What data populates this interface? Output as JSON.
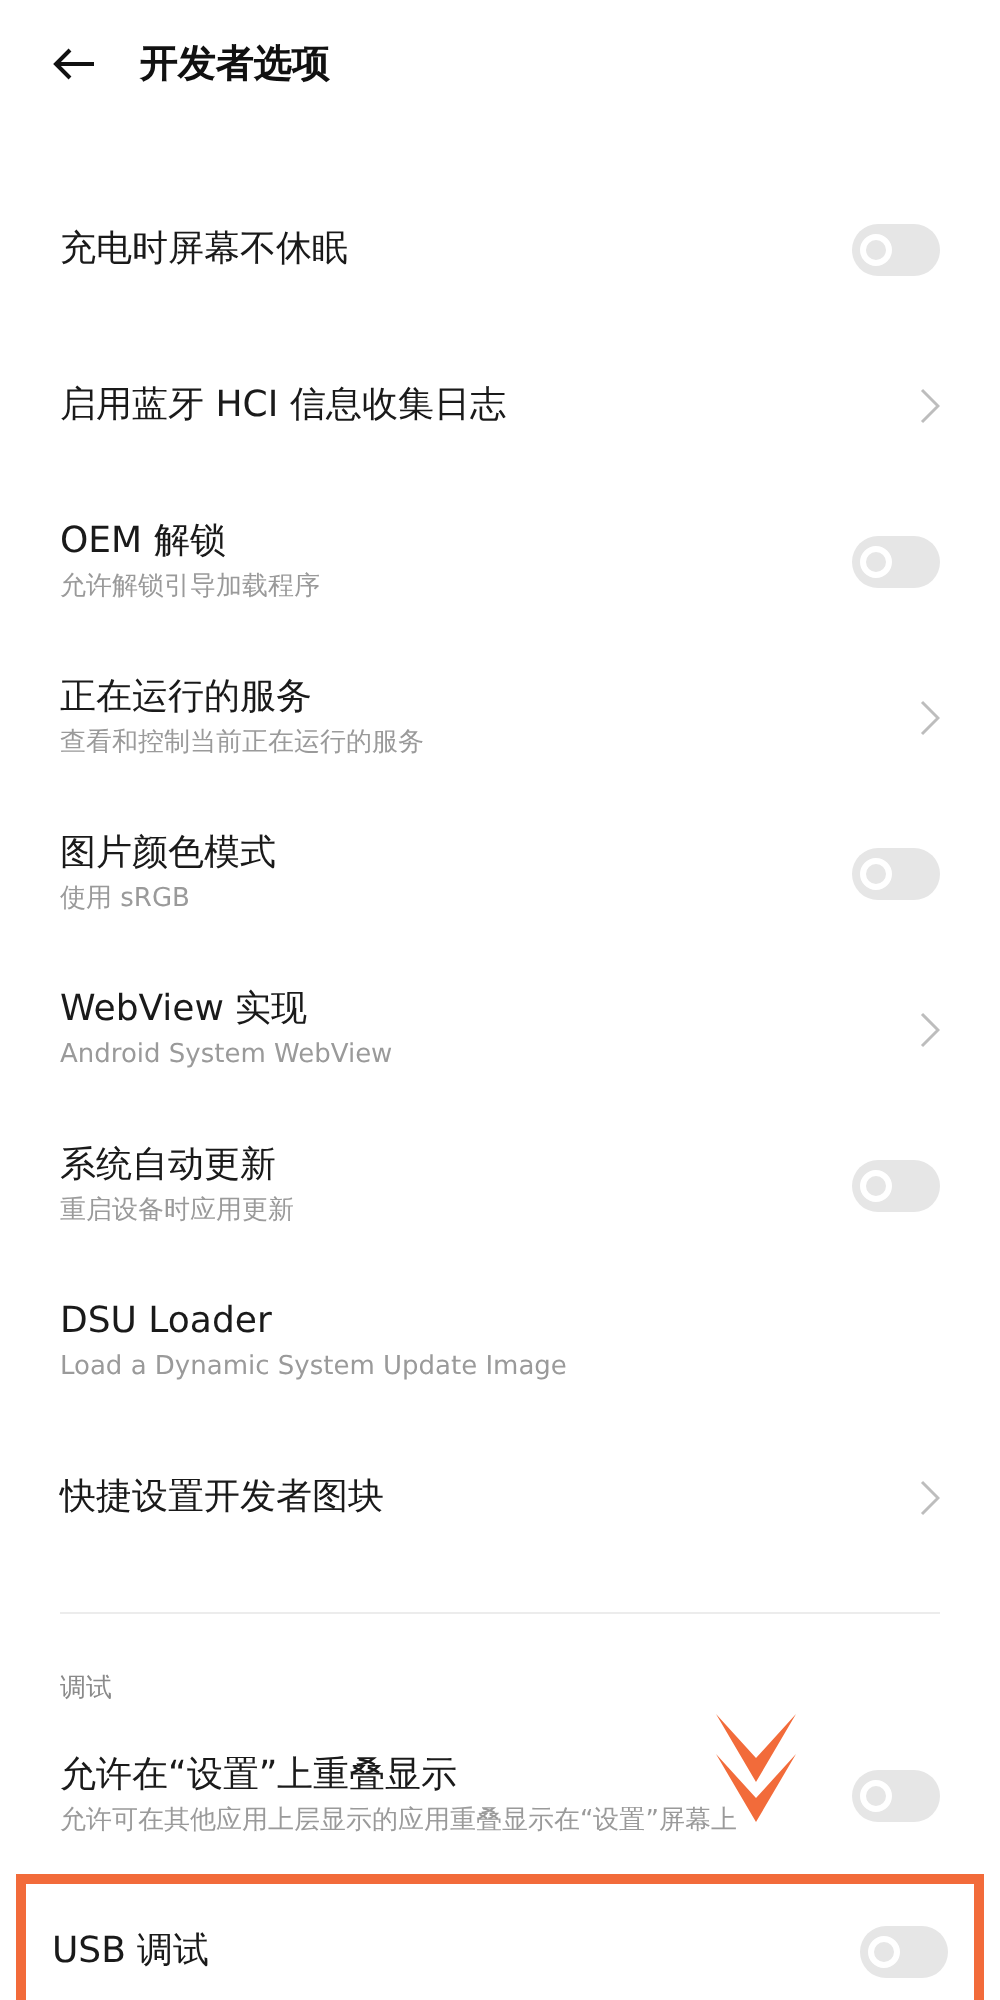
{
  "header": {
    "title": "开发者选项"
  },
  "items": [
    {
      "kind": "toggle",
      "title": "充电时屏幕不休眠",
      "on": false
    },
    {
      "kind": "link",
      "title": "启用蓝牙 HCI 信息收集日志"
    },
    {
      "kind": "toggle",
      "title": "OEM 解锁",
      "subtitle": "允许解锁引导加载程序",
      "on": false
    },
    {
      "kind": "link",
      "title": "正在运行的服务",
      "subtitle": "查看和控制当前正在运行的服务"
    },
    {
      "kind": "toggle",
      "title": "图片颜色模式",
      "subtitle": "使用 sRGB",
      "on": false
    },
    {
      "kind": "link",
      "title": "WebView 实现",
      "subtitle": "Android System WebView"
    },
    {
      "kind": "toggle",
      "title": "系统自动更新",
      "subtitle": "重启设备时应用更新",
      "on": false
    },
    {
      "kind": "plain",
      "title": "DSU Loader",
      "subtitle": "Load a Dynamic System Update Image"
    },
    {
      "kind": "link",
      "title": "快捷设置开发者图块"
    },
    {
      "kind": "divider"
    },
    {
      "kind": "section",
      "title": "调试"
    },
    {
      "kind": "toggle",
      "title": "允许在“设置”上重叠显示",
      "subtitle": "允许可在其他应用上层显示的应用重叠显示在“设置”屏幕上",
      "on": false
    },
    {
      "kind": "toggle",
      "title": "USB 调试",
      "on": false,
      "highlighted": true
    }
  ]
}
